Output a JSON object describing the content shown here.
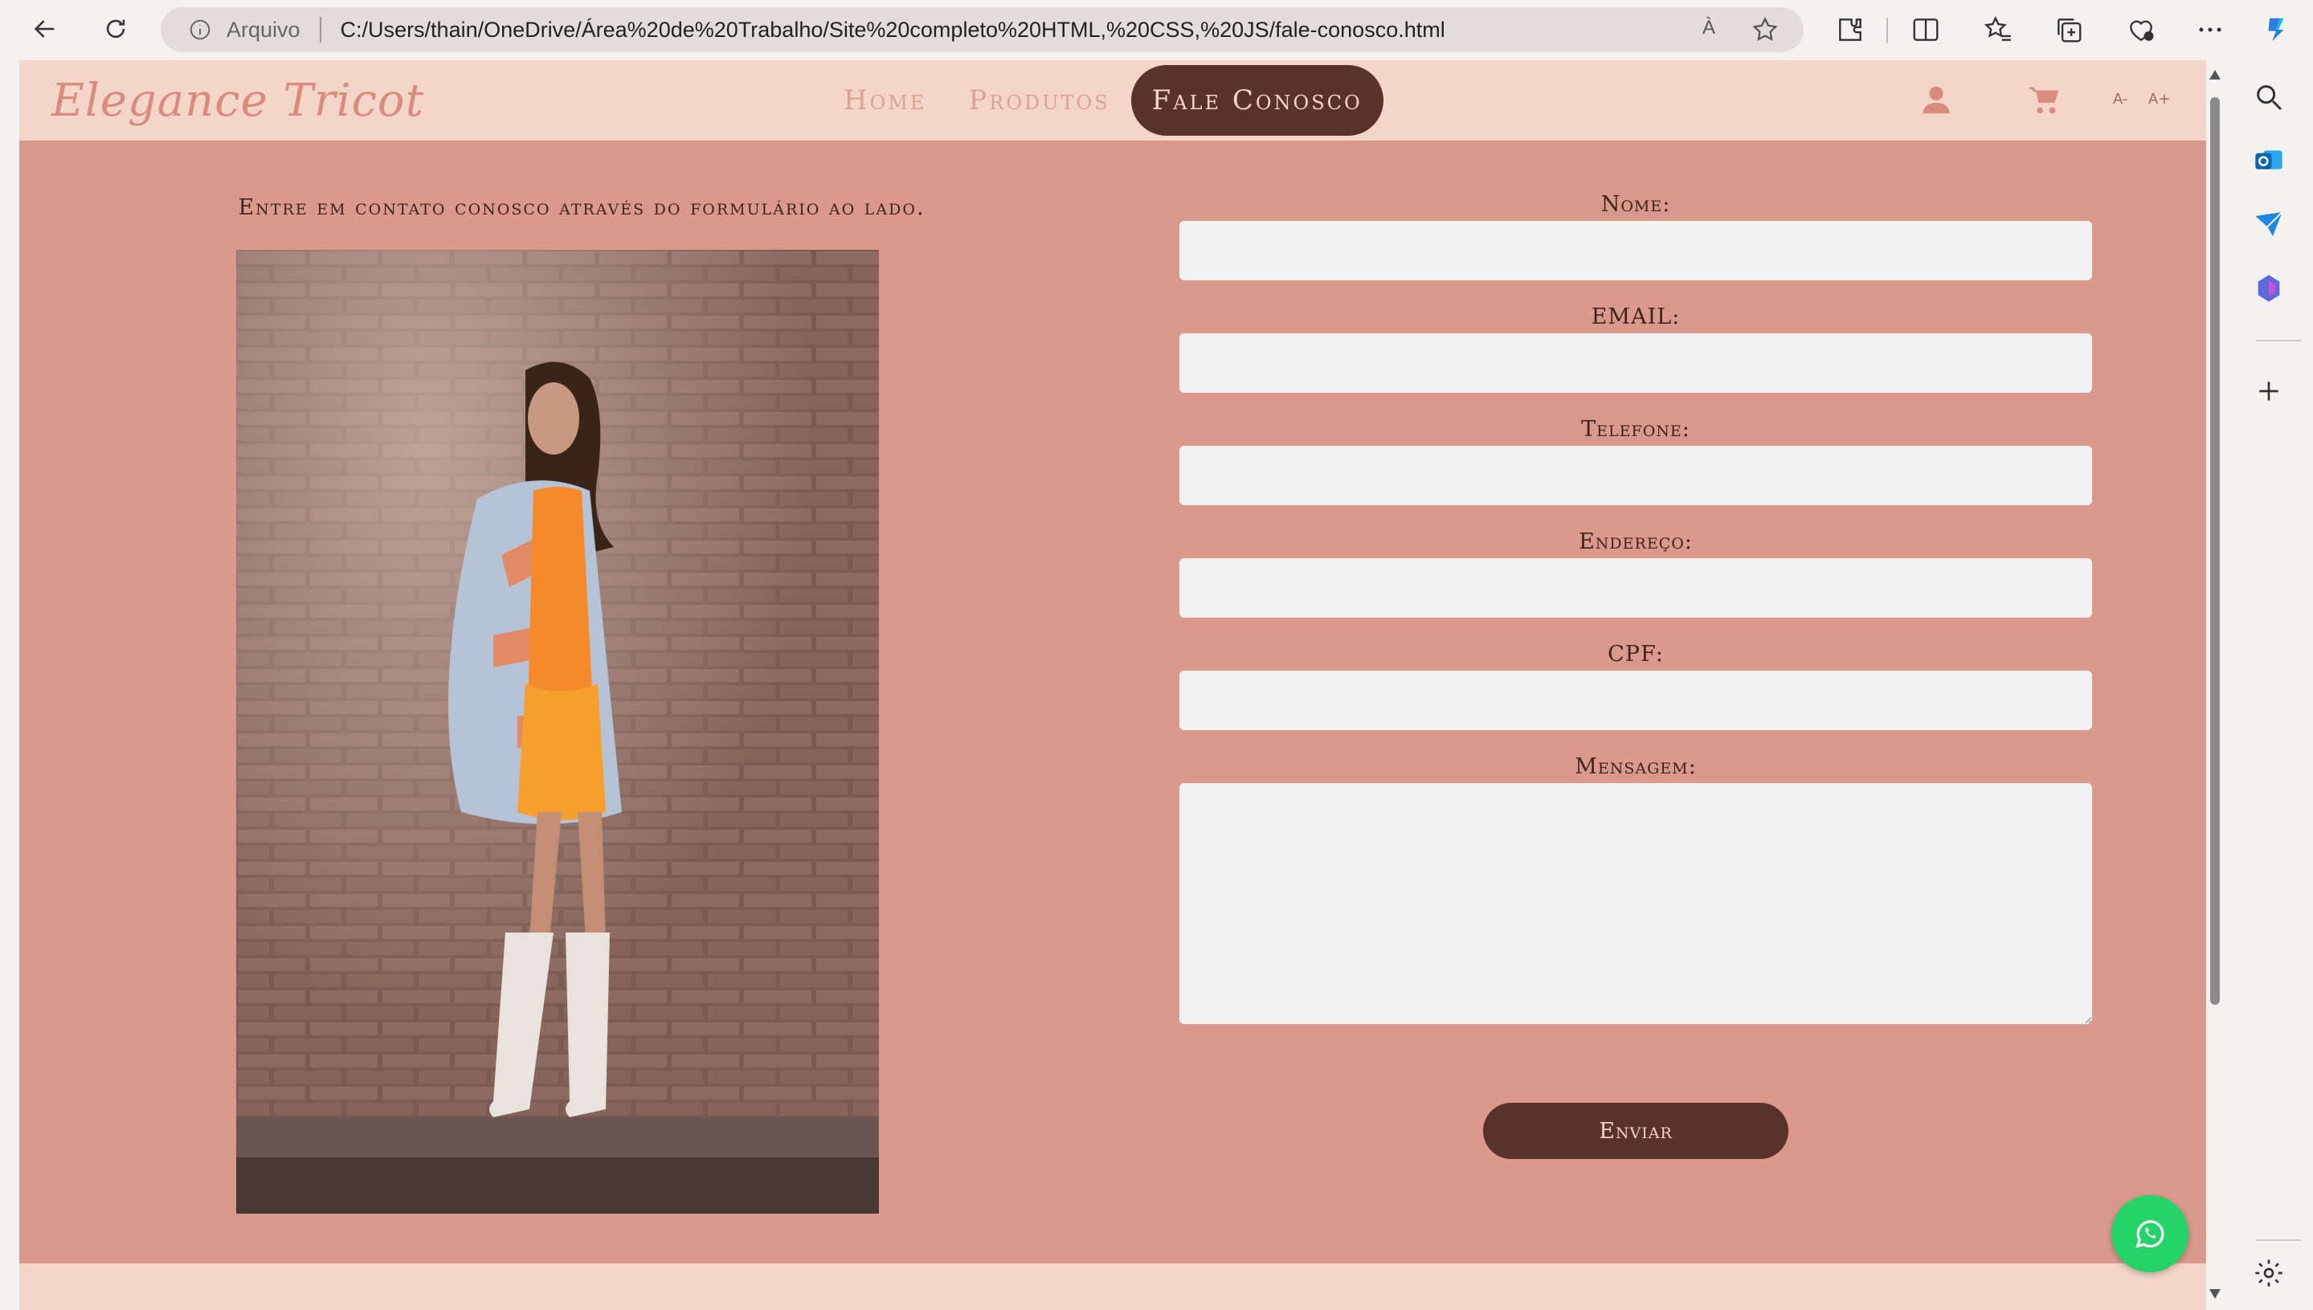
{
  "browser": {
    "address_label": "Arquivo",
    "url": "C:/Users/thain/OneDrive/Área%20de%20Trabalho/Site%20completo%20HTML,%20CSS,%20JS/fale-conosco.html",
    "read_aloud": "À"
  },
  "site": {
    "logo": "Elegance Tricot",
    "nav": [
      {
        "label": "Home"
      },
      {
        "label": "Produtos"
      },
      {
        "label": "Fale Conosco"
      }
    ],
    "font_decrease": "A-",
    "font_increase": "A+"
  },
  "contact": {
    "intro": "Entre em contato conosco através do formulário ao lado.",
    "fields": {
      "nome": "Nome:",
      "email": "EMAIL:",
      "telefone": "Telefone:",
      "endereco": "Endereço:",
      "cpf": "CPF:",
      "mensagem": "Mensagem:"
    },
    "submit": "Enviar"
  },
  "colors": {
    "page_bg": "#da998a",
    "header_bg": "#f4d6c8",
    "accent_dark": "#5a322c",
    "whatsapp": "#25d366"
  }
}
